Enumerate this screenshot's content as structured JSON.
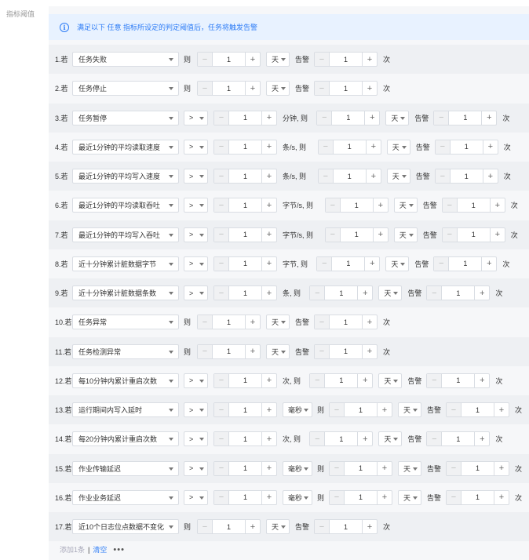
{
  "side_label": "指标阈值",
  "info": {
    "text": "满足以下 任意 指标所设定的判定阈值后，任务将触发告警"
  },
  "rows": [
    {
      "idx": "1.若",
      "metric": "任务失败",
      "t1": "则",
      "v1": "1",
      "unit": "天",
      "t2": "告警",
      "v2": "1",
      "t3": "次"
    },
    {
      "idx": "2.若",
      "metric": "任务停止",
      "t1": "则",
      "v1": "1",
      "unit": "天",
      "t2": "告警",
      "v2": "1",
      "t3": "次"
    },
    {
      "idx": "3.若",
      "metric": "任务暂停",
      "op": ">",
      "v0": "1",
      "t0": "分钟, 则",
      "v1": "1",
      "unit": "天",
      "t2": "告警",
      "v2": "1",
      "t3": "次"
    },
    {
      "idx": "4.若",
      "metric": "最近1分钟的平均读取速度",
      "op": ">",
      "v0": "1",
      "t0": "条/s, 则",
      "v1": "1",
      "unit": "天",
      "t2": "告警",
      "v2": "1",
      "t3": "次"
    },
    {
      "idx": "5.若",
      "metric": "最近1分钟的平均写入速度",
      "op": ">",
      "v0": "1",
      "t0": "条/s, 则",
      "v1": "1",
      "unit": "天",
      "t2": "告警",
      "v2": "1",
      "t3": "次"
    },
    {
      "idx": "6.若",
      "metric": "最近1分钟的平均读取吞吐",
      "op": ">",
      "v0": "1",
      "t0": "字节/s, 则",
      "v1": "1",
      "unit": "天",
      "t2": "告警",
      "v2": "1",
      "t3": "次"
    },
    {
      "idx": "7.若",
      "metric": "最近1分钟的平均写入吞吐",
      "op": ">",
      "v0": "1",
      "t0": "字节/s, 则",
      "v1": "1",
      "unit": "天",
      "t2": "告警",
      "v2": "1",
      "t3": "次"
    },
    {
      "idx": "8.若",
      "metric": "近十分钟累计脏数据字节",
      "op": ">",
      "v0": "1",
      "t0": "字节, 则",
      "v1": "1",
      "unit": "天",
      "t2": "告警",
      "v2": "1",
      "t3": "次"
    },
    {
      "idx": "9.若",
      "metric": "近十分钟累计脏数据条数",
      "op": ">",
      "v0": "1",
      "t0": "条, 则",
      "v1": "1",
      "unit": "天",
      "t2": "告警",
      "v2": "1",
      "t3": "次"
    },
    {
      "idx": "10.若",
      "metric": "任务异常",
      "t1": "则",
      "v1": "1",
      "unit": "天",
      "t2": "告警",
      "v2": "1",
      "t3": "次"
    },
    {
      "idx": "11.若",
      "metric": "任务检测异常",
      "t1": "则",
      "v1": "1",
      "unit": "天",
      "t2": "告警",
      "v2": "1",
      "t3": "次"
    },
    {
      "idx": "12.若",
      "metric": "每10分钟内累计重启次数",
      "op": ">",
      "v0": "1",
      "t0": "次, 则",
      "v1": "1",
      "unit": "天",
      "t2": "告警",
      "v2": "1",
      "t3": "次"
    },
    {
      "idx": "13.若",
      "metric": "运行期间内写入延时",
      "op": ">",
      "v0": "1",
      "unit0": "毫秒",
      "t0": "则",
      "v1": "1",
      "unit": "天",
      "t2": "告警",
      "v2": "1",
      "t3": "次"
    },
    {
      "idx": "14.若",
      "metric": "每20分钟内累计重启次数",
      "op": ">",
      "v0": "1",
      "t0": "次, 则",
      "v1": "1",
      "unit": "天",
      "t2": "告警",
      "v2": "1",
      "t3": "次"
    },
    {
      "idx": "15.若",
      "metric": "作业传输延迟",
      "op": ">",
      "v0": "1",
      "unit0": "毫秒",
      "t0": "则",
      "v1": "1",
      "unit": "天",
      "t2": "告警",
      "v2": "1",
      "t3": "次"
    },
    {
      "idx": "16.若",
      "metric": "作业业务延迟",
      "op": ">",
      "v0": "1",
      "unit0": "毫秒",
      "t0": "则",
      "v1": "1",
      "unit": "天",
      "t2": "告警",
      "v2": "1",
      "t3": "次"
    },
    {
      "idx": "17.若",
      "metric": "近10个日志位点数据不变化",
      "t1": "则",
      "v1": "1",
      "unit": "天",
      "t2": "告警",
      "v2": "1",
      "t3": "次"
    }
  ],
  "stepper": {
    "minus": "−",
    "plus": "+"
  },
  "footer": {
    "add": "添加1条",
    "sep": "|",
    "clear": "清空",
    "more": "•••"
  }
}
